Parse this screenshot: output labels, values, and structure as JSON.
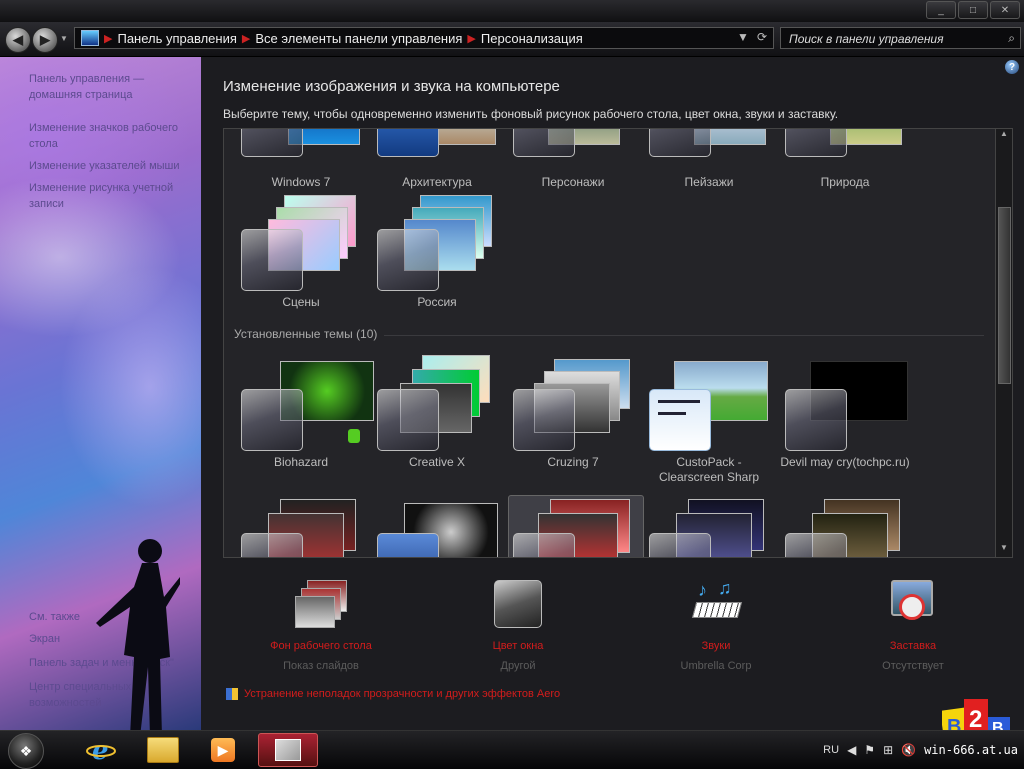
{
  "window": {
    "buttons": [
      "_",
      "□",
      "✕"
    ]
  },
  "nav": {
    "back_glyph": "◀",
    "forward_glyph": "▶",
    "breadcrumbs": [
      "Панель управления",
      "Все элементы панели управления",
      "Персонализация"
    ],
    "search_placeholder": "Поиск в панели управления",
    "icons": [
      "back-icon",
      "forward-icon",
      "control-panel-icon",
      "chevron-down-icon",
      "refresh-icon",
      "search-icon"
    ]
  },
  "sidebar": {
    "links": [
      "Панель управления — домашняя страница",
      "Изменение значков рабочего стола",
      "Изменение указателей мыши",
      "Изменение рисунка учетной записи",
      "См. также",
      "Экран",
      "Панель задач и меню \"Пуск\"",
      "Центр специальных возможностей"
    ]
  },
  "main": {
    "title": "Изменение изображения и звука на компьютере",
    "subtitle": "Выберите тему, чтобы одновременно изменить фоновый рисунок рабочего стола, цвет окна, звуки и заставку.",
    "aero_themes": [
      "Windows 7",
      "Архитектура",
      "Персонажи",
      "Пейзажи",
      "Природа",
      "Сцены",
      "Россия"
    ],
    "installed_header": "Установленные темы (10)",
    "installed_themes": [
      "Biohazard",
      "Creative X",
      "Cruzing 7",
      "CustoPack - Clearscreen Sharp",
      "Devil may cry(tochpc.ru)"
    ],
    "bottom_items": [
      {
        "name": "Фон рабочего стола",
        "value": "Показ слайдов",
        "icon": "wallpaper-icon"
      },
      {
        "name": "Цвет окна",
        "value": "Другой",
        "icon": "window-color-icon"
      },
      {
        "name": "Звуки",
        "value": "Umbrella Corp",
        "icon": "sounds-icon"
      },
      {
        "name": "Заставка",
        "value": "Отсутствует",
        "icon": "screensaver-icon"
      }
    ],
    "aero_link": "Устранение неполадок прозрачности и других эффектов Aero"
  },
  "taskbar": {
    "start_glyph": "❖",
    "lang": "RU",
    "clock": "win-666.at.ua"
  },
  "colors": {
    "link_red": "#d21c1c",
    "content_bg": "#1c1c20"
  }
}
